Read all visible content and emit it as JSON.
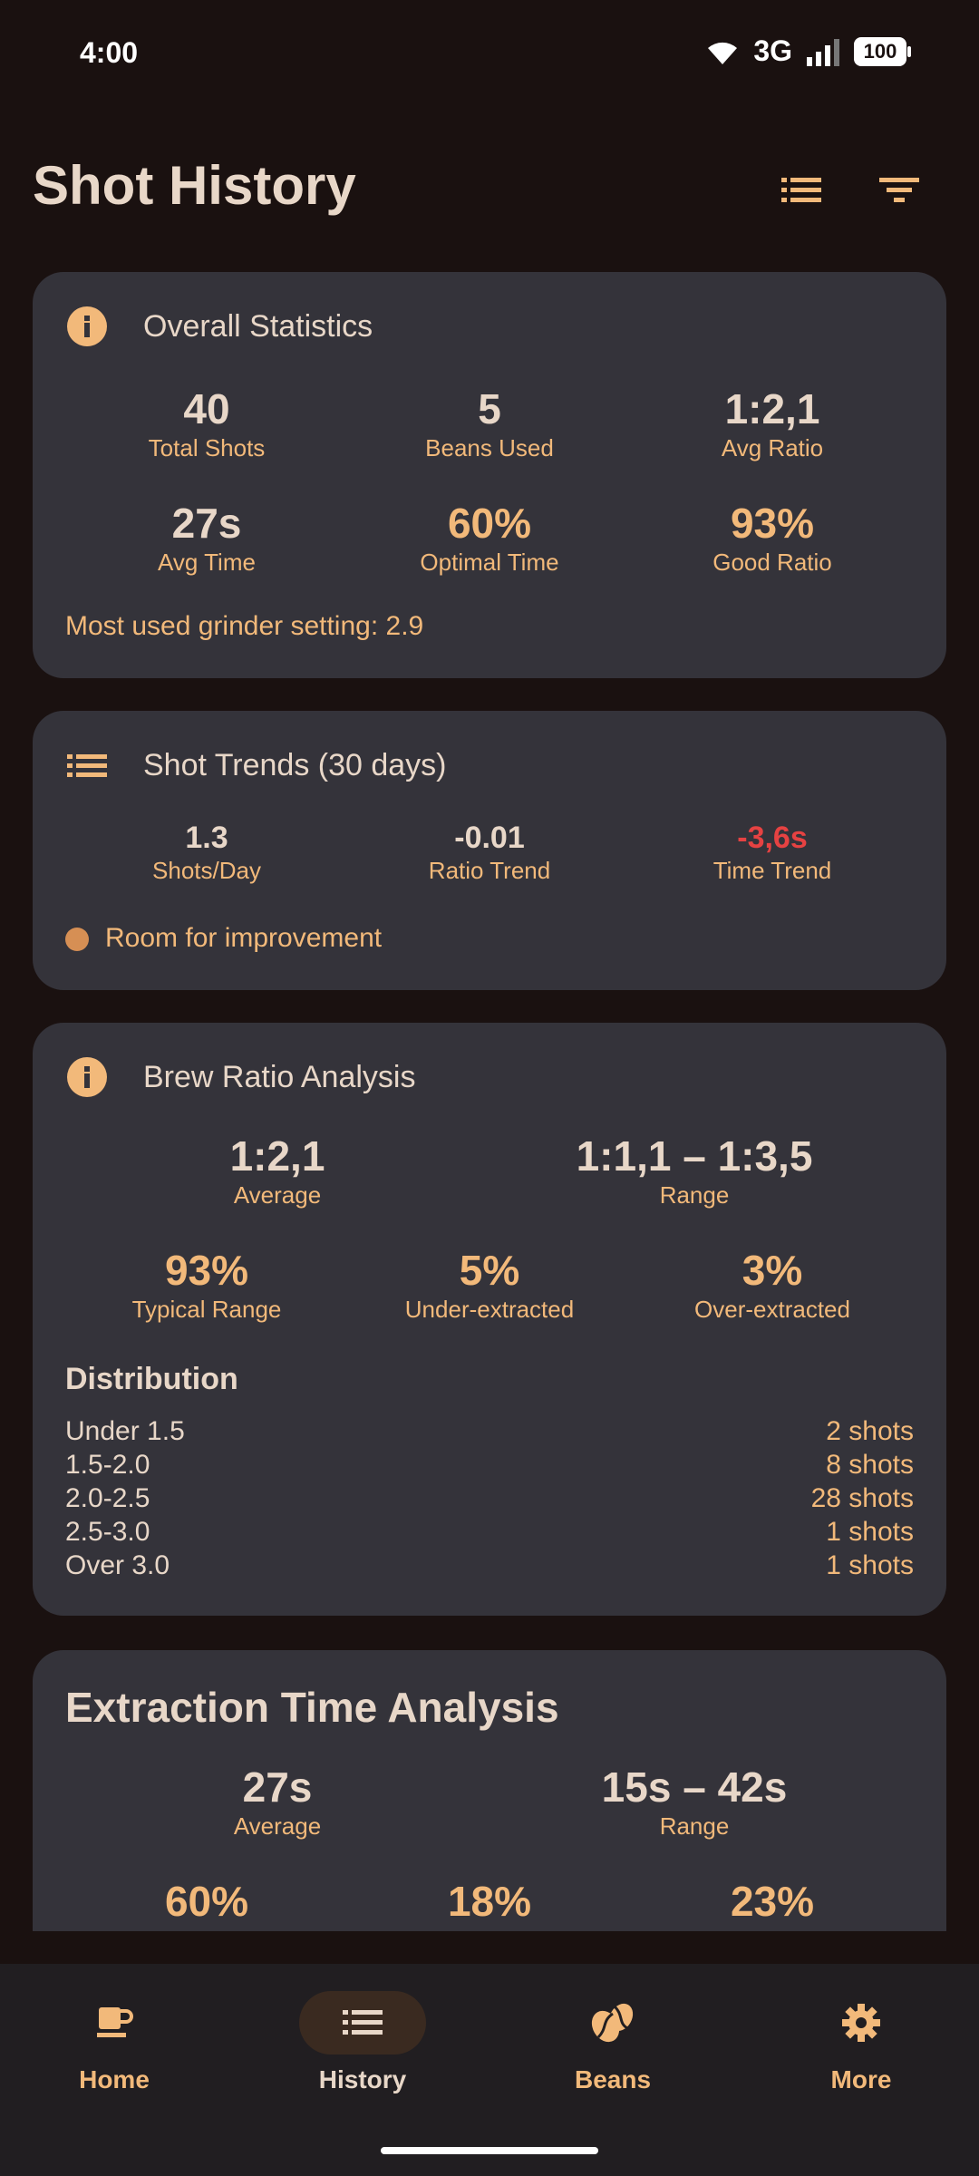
{
  "status_bar": {
    "time": "4:00",
    "network": "3G",
    "battery": "100"
  },
  "header": {
    "title": "Shot History",
    "icons": [
      "list-icon",
      "filter-icon"
    ]
  },
  "overall": {
    "title": "Overall Statistics",
    "total_shots": {
      "value": "40",
      "label": "Total Shots"
    },
    "beans_used": {
      "value": "5",
      "label": "Beans Used"
    },
    "avg_ratio": {
      "value": "1:2,1",
      "label": "Avg Ratio"
    },
    "avg_time": {
      "value": "27s",
      "label": "Avg Time"
    },
    "optimal_time": {
      "value": "60%",
      "label": "Optimal Time"
    },
    "good_ratio": {
      "value": "93%",
      "label": "Good Ratio"
    },
    "note": "Most used grinder setting: 2.9"
  },
  "trends": {
    "title": "Shot Trends (30 days)",
    "shots_per_day": {
      "value": "1.3",
      "label": "Shots/Day"
    },
    "ratio_trend": {
      "value": "-0.01",
      "label": "Ratio Trend"
    },
    "time_trend": {
      "value": "-3,6s",
      "label": "Time Trend"
    },
    "status": "Room for improvement"
  },
  "brew_ratio": {
    "title": "Brew Ratio Analysis",
    "average": {
      "value": "1:2,1",
      "label": "Average"
    },
    "range": {
      "value": "1:1,1 – 1:3,5",
      "label": "Range"
    },
    "typical": {
      "value": "93%",
      "label": "Typical Range"
    },
    "under": {
      "value": "5%",
      "label": "Under-extracted"
    },
    "over": {
      "value": "3%",
      "label": "Over-extracted"
    },
    "distribution_title": "Distribution",
    "distribution": [
      {
        "bucket": "Under 1.5",
        "count": "2 shots"
      },
      {
        "bucket": "1.5-2.0",
        "count": "8 shots"
      },
      {
        "bucket": "2.0-2.5",
        "count": "28 shots"
      },
      {
        "bucket": "2.5-3.0",
        "count": "1 shots"
      },
      {
        "bucket": "Over 3.0",
        "count": "1 shots"
      }
    ]
  },
  "extraction": {
    "title": "Extraction Time Analysis",
    "average": {
      "value": "27s",
      "label": "Average"
    },
    "range": {
      "value": "15s – 42s",
      "label": "Range"
    },
    "p1": {
      "value": "60%"
    },
    "p2": {
      "value": "18%"
    },
    "p3": {
      "value": "23%"
    }
  },
  "nav": [
    {
      "label": "Home",
      "icon": "coffee-cup-icon"
    },
    {
      "label": "History",
      "icon": "list-icon"
    },
    {
      "label": "Beans",
      "icon": "coffee-bean-icon"
    },
    {
      "label": "More",
      "icon": "gear-icon"
    }
  ],
  "colors": {
    "accent": "#f2b97a",
    "card": "#34333a",
    "background": "#1a1110",
    "negative": "#e64242"
  }
}
